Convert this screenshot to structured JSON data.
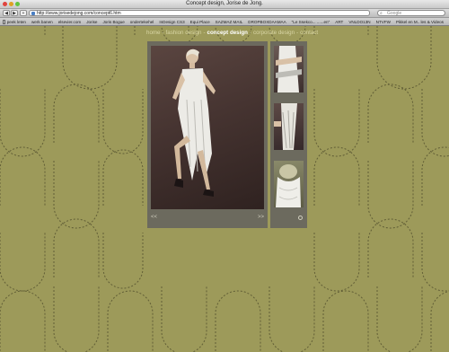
{
  "window": {
    "title": "Concept design, Jorise de Jong."
  },
  "toolbar": {
    "url": "http://www.jorisedejong.com/concept6.htm",
    "search_placeholder": "Google"
  },
  "bookmarks": [
    "peek leten",
    "werk banen",
    "elsevier.com",
    "Jorise",
    "Joris Bogue",
    "ondertekehel",
    "InDesign CS3",
    "Equi Place",
    "SAZMAZ MAIL",
    "DROPBOXDAAMAA",
    "\"Le Ssekco... ......en\"",
    "ART",
    "VNLDO13N",
    "NTVFW",
    "Pikkel en M.. les & Videos"
  ],
  "nav": {
    "items": [
      {
        "label": "home",
        "active": false
      },
      {
        "label": "fashion design",
        "active": false
      },
      {
        "label": "concept design",
        "active": true
      },
      {
        "label": "corporate design",
        "active": false
      },
      {
        "label": "contact",
        "active": false
      }
    ],
    "separator": "-"
  },
  "gallery": {
    "prev_label": "<<",
    "next_label": ">>"
  },
  "colors": {
    "background": "#9d9a5a",
    "panel": "#6c6a5e",
    "nav_text": "#d9d6a6",
    "nav_active": "#ffffff"
  }
}
